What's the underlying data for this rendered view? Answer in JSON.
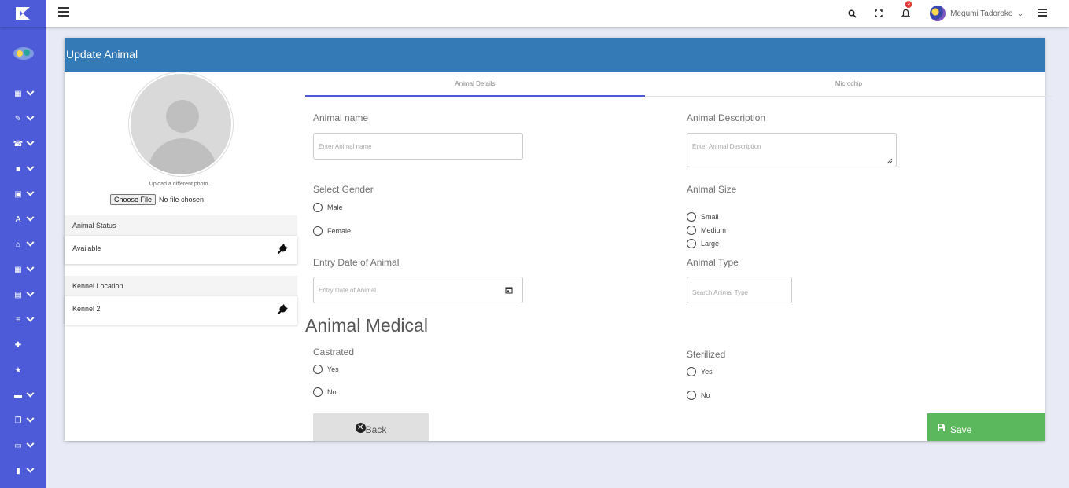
{
  "header": {
    "user_name": "Megumi Tadoroko",
    "notification_count": "3"
  },
  "page": {
    "title": "Update Animal"
  },
  "left": {
    "upload_text": "Upload a different photo...",
    "file_button": "Choose File",
    "file_status": "No file chosen",
    "status_title": "Animal Status",
    "status_value": "Available",
    "kennel_title": "Kennel Location",
    "kennel_value": "Kennel 2"
  },
  "tabs": [
    {
      "label": "Animal Details",
      "active": true
    },
    {
      "label": "Microchip",
      "active": false
    }
  ],
  "form": {
    "animal_name_label": "Animal name",
    "animal_name_placeholder": "Enter Animal name",
    "description_label": "Animal Description",
    "description_placeholder": "Enter Animal Description",
    "gender_label": "Select Gender",
    "gender_options": [
      "Male",
      "Female"
    ],
    "size_label": "Animal Size",
    "size_options": [
      "Small",
      "Medium",
      "Large"
    ],
    "entry_date_label": "Entry Date of Animal",
    "entry_date_placeholder": "Entry Date of Animal",
    "type_label": "Animal Type",
    "type_placeholder": "Search Animal Type",
    "medical_title": "Animal Medical",
    "castrated_label": "Castrated",
    "castrated_options": [
      "Yes",
      "No"
    ],
    "sterilized_label": "Sterilized",
    "sterilized_options": [
      "Yes",
      "No"
    ]
  },
  "buttons": {
    "back": "Back",
    "save": "Save"
  },
  "colors": {
    "sidebar": "#4d5bd8",
    "header": "#337ab7",
    "save": "#5cb85c"
  },
  "icons": {
    "sidebar": [
      "dashboard-icon",
      "pencil-icon",
      "phone-icon",
      "briefcase-icon",
      "calendar-icon",
      "font-icon",
      "home-icon",
      "grid-icon",
      "clipboard-icon",
      "list-icon",
      "medkit-icon",
      "star-icon",
      "table-icon",
      "copy-icon",
      "shop-icon",
      "map-icon"
    ]
  }
}
